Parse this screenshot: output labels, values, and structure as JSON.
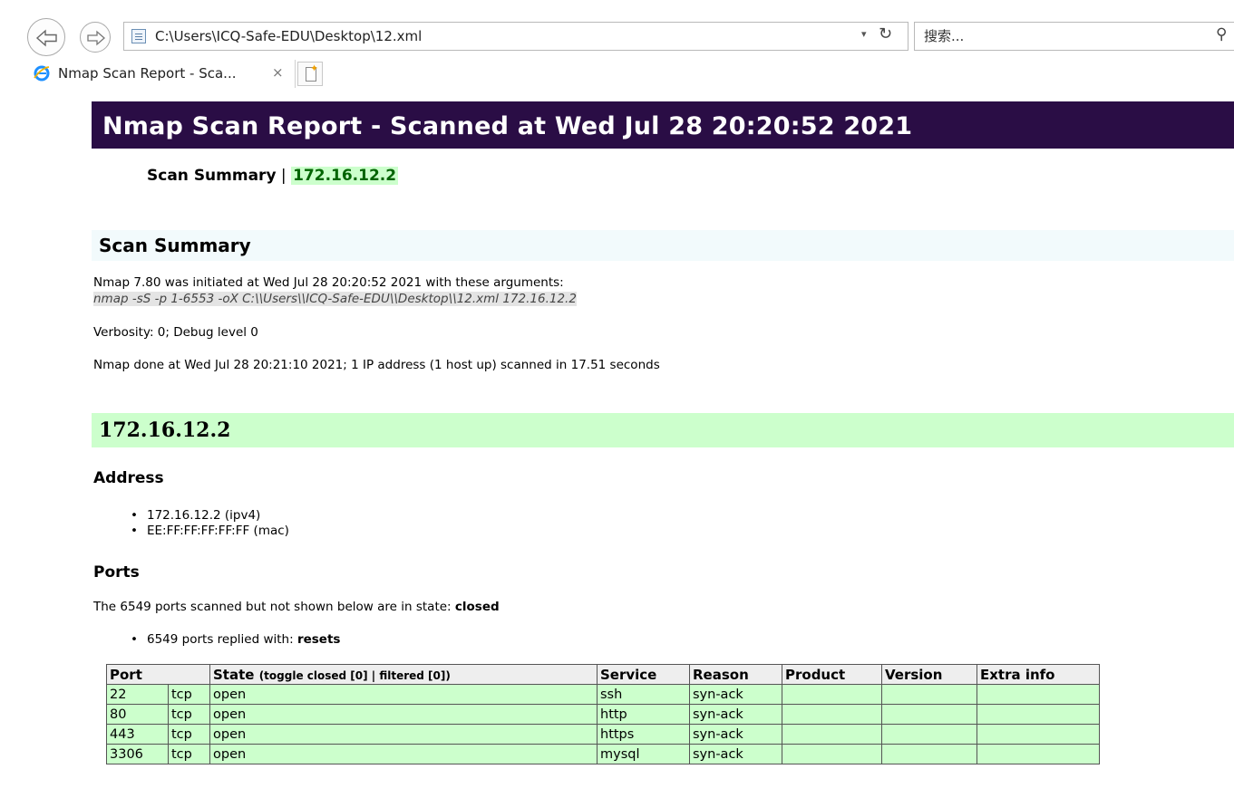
{
  "browser": {
    "url": "C:\\Users\\ICQ-Safe-EDU\\Desktop\\12.xml",
    "search_placeholder": "搜索...",
    "tab_title": "Nmap Scan Report - Sca...",
    "tab_close": "×"
  },
  "report": {
    "banner": "Nmap Scan Report - Scanned at Wed Jul 28 20:20:52 2021",
    "nav_summary": "Scan Summary",
    "nav_sep": " | ",
    "nav_host": "172.16.12.2",
    "summary_heading": "Scan Summary",
    "init_line": "Nmap 7.80 was initiated at Wed Jul 28 20:20:52 2021 with these arguments:",
    "arguments": "nmap -sS -p 1-6553 -oX C:\\\\Users\\\\ICQ-Safe-EDU\\\\Desktop\\\\12.xml 172.16.12.2",
    "verbosity": "Verbosity: 0; Debug level 0",
    "done_line": "Nmap done at Wed Jul 28 20:21:10 2021; 1 IP address (1 host up) scanned in 17.51 seconds"
  },
  "host": {
    "heading": "172.16.12.2",
    "address_heading": "Address",
    "addresses": [
      "172.16.12.2 (ipv4)",
      "EE:FF:FF:FF:FF:FF (mac)"
    ],
    "ports_heading": "Ports",
    "closed_prefix": "The 6549 ports scanned but not shown below are in state: ",
    "closed_state": "closed",
    "reply_prefix": "6549 ports replied with: ",
    "reply_reason": "resets"
  },
  "ports_table": {
    "headers": {
      "port": "Port",
      "state": "State",
      "toggle": "(toggle closed [0] | filtered [0])",
      "service": "Service",
      "reason": "Reason",
      "product": "Product",
      "version": "Version",
      "extra": "Extra info"
    },
    "rows": [
      {
        "port": "22",
        "proto": "tcp",
        "state": "open",
        "service": "ssh",
        "reason": "syn-ack",
        "product": "",
        "version": "",
        "extra": ""
      },
      {
        "port": "80",
        "proto": "tcp",
        "state": "open",
        "service": "http",
        "reason": "syn-ack",
        "product": "",
        "version": "",
        "extra": ""
      },
      {
        "port": "443",
        "proto": "tcp",
        "state": "open",
        "service": "https",
        "reason": "syn-ack",
        "product": "",
        "version": "",
        "extra": ""
      },
      {
        "port": "3306",
        "proto": "tcp",
        "state": "open",
        "service": "mysql",
        "reason": "syn-ack",
        "product": "",
        "version": "",
        "extra": ""
      }
    ]
  },
  "colors": {
    "banner_bg": "#2a0d45",
    "host_bg": "#ccffcc",
    "summary_bg": "#f2fafc",
    "link_green": "#006400"
  },
  "icons": [
    "back-arrow-icon",
    "forward-arrow-icon",
    "page-icon",
    "dropdown-icon",
    "refresh-icon",
    "search-icon",
    "ie-logo-icon",
    "close-icon",
    "new-tab-icon"
  ]
}
